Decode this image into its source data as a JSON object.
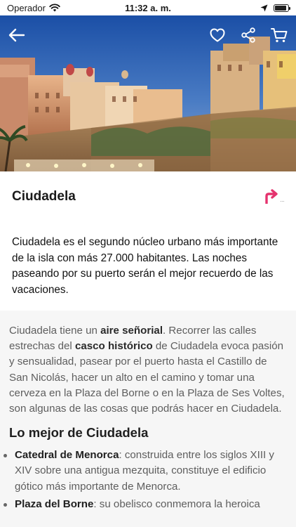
{
  "status_bar": {
    "carrier": "Operador",
    "time": "11:32 a. m.",
    "battery_level": 0.9
  },
  "hero": {
    "icons": [
      "back-arrow-icon",
      "heart-icon",
      "share-icon",
      "cart-icon"
    ]
  },
  "title": "Ciudadela",
  "colors": {
    "accent": "#e5336e",
    "body_text": "#5e5e5e",
    "intro_text": "#111111"
  },
  "intro": "Ciudadela es el segundo núcleo urbano más importante de la isla con más 27.000 habitantes. Las noches paseando por su puerto serán el mejor recuerdo de las vacaciones.",
  "body": {
    "p1": "Ciudadela tiene un ",
    "b1": "aire señorial",
    "p2": ". Recorrer las calles estrechas del ",
    "b2": "casco histórico",
    "p3": " de Ciudadela evoca pasión y sensualidad, pasear por el puerto hasta el Castillo de San Nicolás, hacer un alto en el camino y tomar una cerveza en la Plaza del Borne o en la Plaza de Ses Voltes, son algunas de las cosas que podrás hacer en Ciudadela."
  },
  "best_of": {
    "heading": "Lo mejor de Ciudadela",
    "items": [
      {
        "name": "Catedral de Menorca",
        "text": ": construida entre los siglos XIII y XIV sobre una antigua mezquita, constituye el edificio gótico más importante de Menorca."
      },
      {
        "name": "Plaza del Borne",
        "text": ": su obelisco conmemora la heroica"
      }
    ]
  }
}
